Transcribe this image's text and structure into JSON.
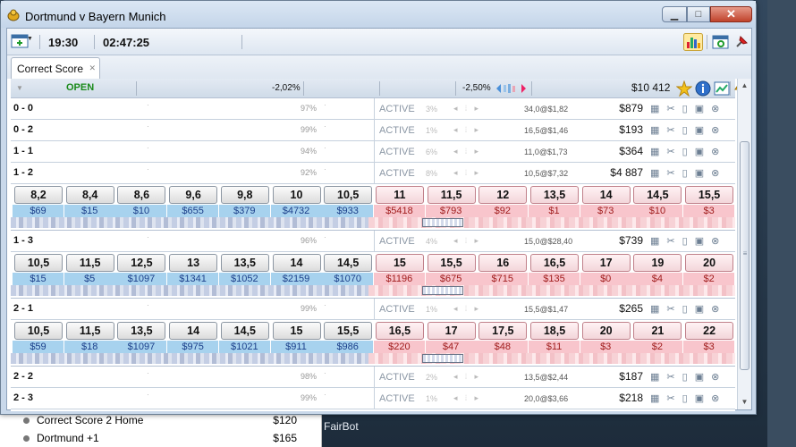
{
  "window": {
    "title": "Dortmund v Bayern Munich",
    "min": "▁",
    "max": "□",
    "close": "✕"
  },
  "toolbar": {
    "time": "19:30",
    "countdown": "02:47:25"
  },
  "tab": {
    "label": "Correct Score",
    "close": "✕"
  },
  "status": {
    "state": "OPEN",
    "pct_back": "-2,02%",
    "pct_lay": "-2,50%",
    "total": "$10 412"
  },
  "colors": {
    "open": "#1a8a1a",
    "back": "#a7d2ee",
    "lay": "#f8c5cc"
  },
  "icons": [
    "chart-icon",
    "refresh-icon",
    "pin-icon",
    "star-icon",
    "info-icon",
    "graph-icon",
    "lightning-icon"
  ],
  "rows": [
    {
      "name": "0 - 0",
      "pct": "97%",
      "state": "ACTIVE",
      "small": "3%",
      "odds": "34,0@$1,82",
      "matched": "$879"
    },
    {
      "name": "0 - 2",
      "pct": "99%",
      "state": "ACTIVE",
      "small": "1%",
      "odds": "16,5@$1,46",
      "matched": "$193"
    },
    {
      "name": "1 - 1",
      "pct": "94%",
      "state": "ACTIVE",
      "small": "6%",
      "odds": "11,0@$1,73",
      "matched": "$364"
    },
    {
      "name": "1 - 2",
      "pct": "92%",
      "state": "ACTIVE",
      "small": "8%",
      "odds": "10,5@$7,32",
      "matched": "$4 887"
    },
    {
      "name": "1 - 3",
      "pct": "96%",
      "state": "ACTIVE",
      "small": "4%",
      "odds": "15,0@$28,40",
      "matched": "$739"
    },
    {
      "name": "2 - 1",
      "pct": "99%",
      "state": "ACTIVE",
      "small": "1%",
      "odds": "15,5@$1,47",
      "matched": "$265"
    },
    {
      "name": "2 - 2",
      "pct": "98%",
      "state": "ACTIVE",
      "small": "2%",
      "odds": "13,5@$2,44",
      "matched": "$187"
    },
    {
      "name": "2 - 3",
      "pct": "99%",
      "state": "ACTIVE",
      "small": "1%",
      "odds": "20,0@$3,66",
      "matched": "$218"
    }
  ],
  "ladders": [
    {
      "prices": [
        "8,2",
        "8,4",
        "8,6",
        "9,6",
        "9,8",
        "10",
        "10,5",
        "11",
        "11,5",
        "12",
        "13,5",
        "14",
        "14,5",
        "15,5"
      ],
      "amounts": [
        "$69",
        "$15",
        "$10",
        "$655",
        "$379",
        "$4732",
        "$933",
        "$5418",
        "$793",
        "$92",
        "$1",
        "$73",
        "$10",
        "$3"
      ]
    },
    {
      "prices": [
        "10,5",
        "11,5",
        "12,5",
        "13",
        "13,5",
        "14",
        "14,5",
        "15",
        "15,5",
        "16",
        "16,5",
        "17",
        "19",
        "20"
      ],
      "amounts": [
        "$15",
        "$5",
        "$1097",
        "$1341",
        "$1052",
        "$2159",
        "$1070",
        "$1196",
        "$675",
        "$715",
        "$135",
        "$0",
        "$4",
        "$2"
      ]
    },
    {
      "prices": [
        "10,5",
        "11,5",
        "13,5",
        "14",
        "14,5",
        "15",
        "15,5",
        "16,5",
        "17",
        "17,5",
        "18,5",
        "20",
        "21",
        "22"
      ],
      "amounts": [
        "$59",
        "$18",
        "$1097",
        "$975",
        "$1021",
        "$911",
        "$986",
        "$220",
        "$47",
        "$48",
        "$11",
        "$3",
        "$2",
        "$3"
      ]
    }
  ],
  "background": {
    "items": [
      {
        "label": "Correct Score 2 Home",
        "amount": "$120"
      },
      {
        "label": "Dortmund +1",
        "amount": "$165"
      }
    ],
    "fairbot": "FairBot"
  }
}
